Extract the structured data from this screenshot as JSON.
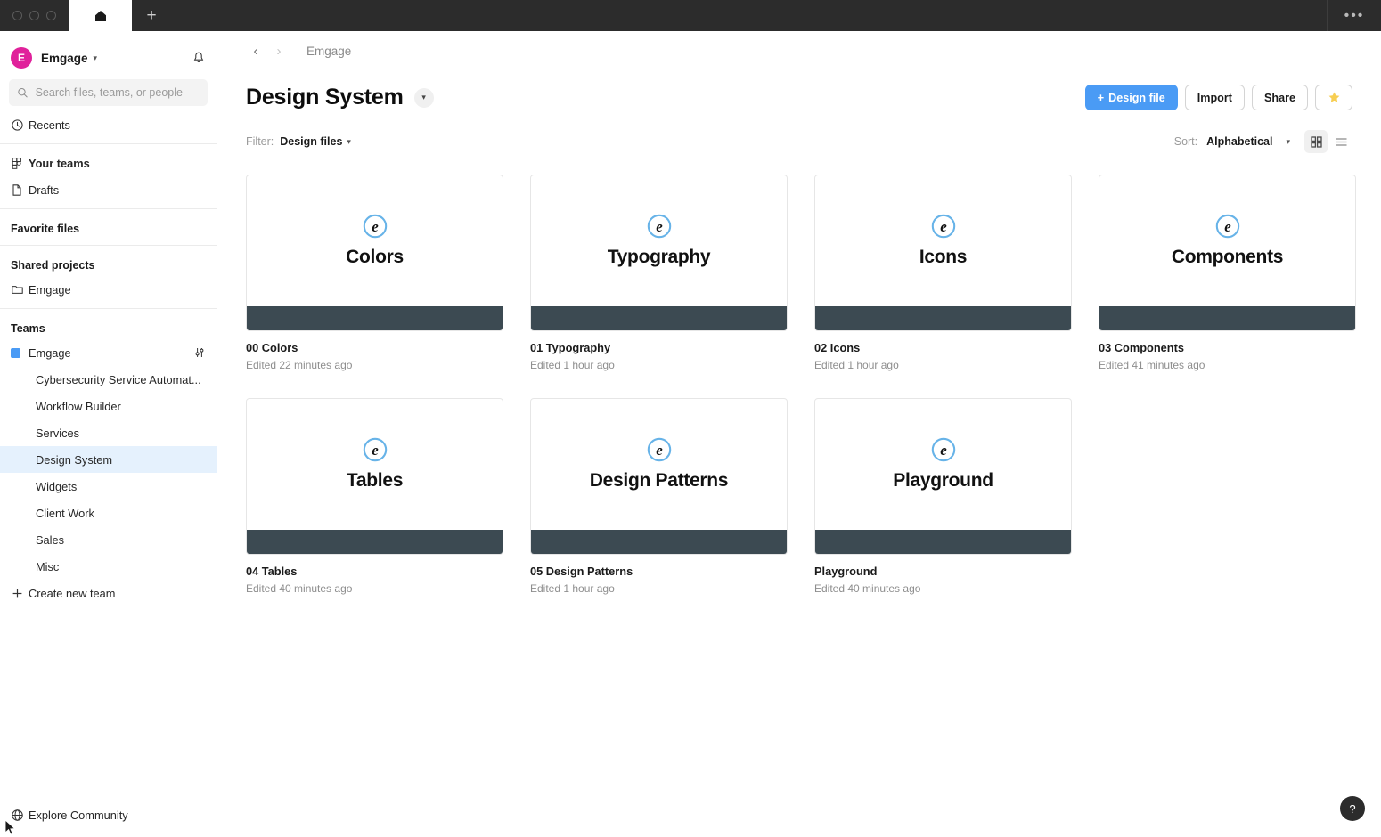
{
  "titlebar": {
    "traffic_lights": [
      "close",
      "minimize",
      "maximize"
    ],
    "home_tab_icon": "home-icon",
    "new_tab_label": "+",
    "overflow_menu_label": "•••"
  },
  "sidebar": {
    "account": {
      "avatar_initial": "E",
      "name": "Emgage",
      "caret": "⌄",
      "notifications_icon": "bell-icon"
    },
    "search": {
      "placeholder": "Search files, teams, or people",
      "value": "",
      "icon": "search-icon"
    },
    "recents": {
      "label": "Recents",
      "icon": "clock-icon"
    },
    "your_teams": {
      "label": "Your teams",
      "icon": "teams-icon"
    },
    "drafts": {
      "label": "Drafts",
      "icon": "file-icon"
    },
    "favorite_files_heading": "Favorite files",
    "shared_projects_heading": "Shared projects",
    "shared_projects": [
      {
        "label": "Emgage",
        "icon": "folder-icon"
      }
    ],
    "teams_heading": "Teams",
    "teams": [
      {
        "label": "Emgage",
        "icon": "color-swatch",
        "swatch_color": "#4a9bf5",
        "settings_icon": "sliders-icon",
        "selected": false,
        "top": true
      },
      {
        "label": "Cybersecurity Service Automat...",
        "selected": false
      },
      {
        "label": "Workflow Builder",
        "selected": false
      },
      {
        "label": "Services",
        "selected": false
      },
      {
        "label": "Design System",
        "selected": true
      },
      {
        "label": "Widgets",
        "selected": false
      },
      {
        "label": "Client Work",
        "selected": false
      },
      {
        "label": "Sales",
        "selected": false
      },
      {
        "label": "Misc",
        "selected": false
      }
    ],
    "create_new_team": {
      "label": "Create new team",
      "icon": "plus-icon"
    },
    "explore_community": {
      "label": "Explore Community",
      "icon": "globe-icon"
    }
  },
  "main": {
    "breadcrumb": {
      "back_icon": "chevron-left-icon",
      "forward_icon": "chevron-right-icon",
      "path": "Emgage"
    },
    "page_title": "Design System",
    "title_caret": "⌄",
    "actions": {
      "design_file": "Design file",
      "design_file_prefix": "+",
      "import": "Import",
      "share": "Share",
      "favorite_icon": "star-icon"
    },
    "filter": {
      "label": "Filter:",
      "value": "Design files",
      "caret": "⌄"
    },
    "sort": {
      "label": "Sort:",
      "value": "Alphabetical",
      "caret": "⌄"
    },
    "view": {
      "grid_icon": "grid-view-icon",
      "list_icon": "list-view-icon",
      "active": "grid"
    },
    "files": [
      {
        "thumb_title": "Colors",
        "name": "00 Colors",
        "meta": "Edited 22 minutes ago",
        "logo": "emgage-e-logo"
      },
      {
        "thumb_title": "Typography",
        "name": "01 Typography",
        "meta": "Edited 1 hour ago",
        "logo": "emgage-e-logo"
      },
      {
        "thumb_title": "Icons",
        "name": "02 Icons",
        "meta": "Edited 1 hour ago",
        "logo": "emgage-e-logo"
      },
      {
        "thumb_title": "Components",
        "name": "03 Components",
        "meta": "Edited 41 minutes ago",
        "logo": "emgage-e-logo"
      },
      {
        "thumb_title": "Tables",
        "name": "04 Tables",
        "meta": "Edited 40 minutes ago",
        "logo": "emgage-e-logo"
      },
      {
        "thumb_title": "Design Patterns",
        "name": "05 Design Patterns",
        "meta": "Edited 1 hour ago",
        "logo": "emgage-e-logo"
      },
      {
        "thumb_title": "Playground",
        "name": "Playground",
        "meta": "Edited 40 minutes ago",
        "logo": "emgage-e-logo"
      }
    ],
    "help_button": "?"
  },
  "colors": {
    "accent_blue": "#4a9bf5",
    "thumb_band": "#3c4a52",
    "avatar_pink": "#e0219b",
    "selected_row": "#e5f1fd",
    "star_yellow": "#f7ce52",
    "logo_ring": "#67b3e8"
  }
}
